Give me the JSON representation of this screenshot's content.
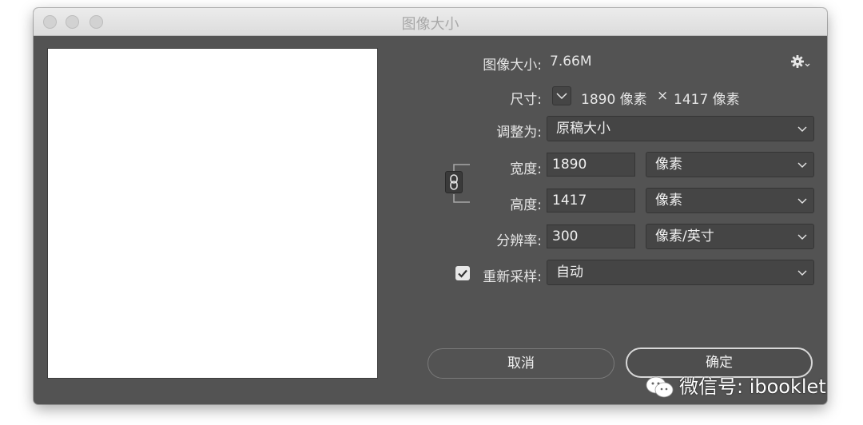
{
  "window": {
    "title": "图像大小"
  },
  "image_size": {
    "label": "图像大小:",
    "value": "7.66M"
  },
  "dimensions": {
    "label": "尺寸:",
    "width": "1890 像素",
    "times": "×",
    "height": "1417 像素"
  },
  "fit_to": {
    "label": "调整为:",
    "selected": "原稿大小"
  },
  "width_row": {
    "label": "宽度:",
    "value": "1890",
    "unit": "像素"
  },
  "height_row": {
    "label": "高度:",
    "value": "1417",
    "unit": "像素"
  },
  "resolution_row": {
    "label": "分辨率:",
    "value": "300",
    "unit": "像素/英寸"
  },
  "resample": {
    "label": "重新采样:",
    "checked": true,
    "selected": "自动"
  },
  "buttons": {
    "cancel": "取消",
    "ok": "确定"
  },
  "watermark": {
    "text": "微信号: ibooklet"
  },
  "icons": {
    "gear": "gear-icon",
    "link": "chain-link-icon",
    "chevron": "chevron-down-icon",
    "check": "checkmark-icon",
    "wechat": "wechat-icon"
  }
}
